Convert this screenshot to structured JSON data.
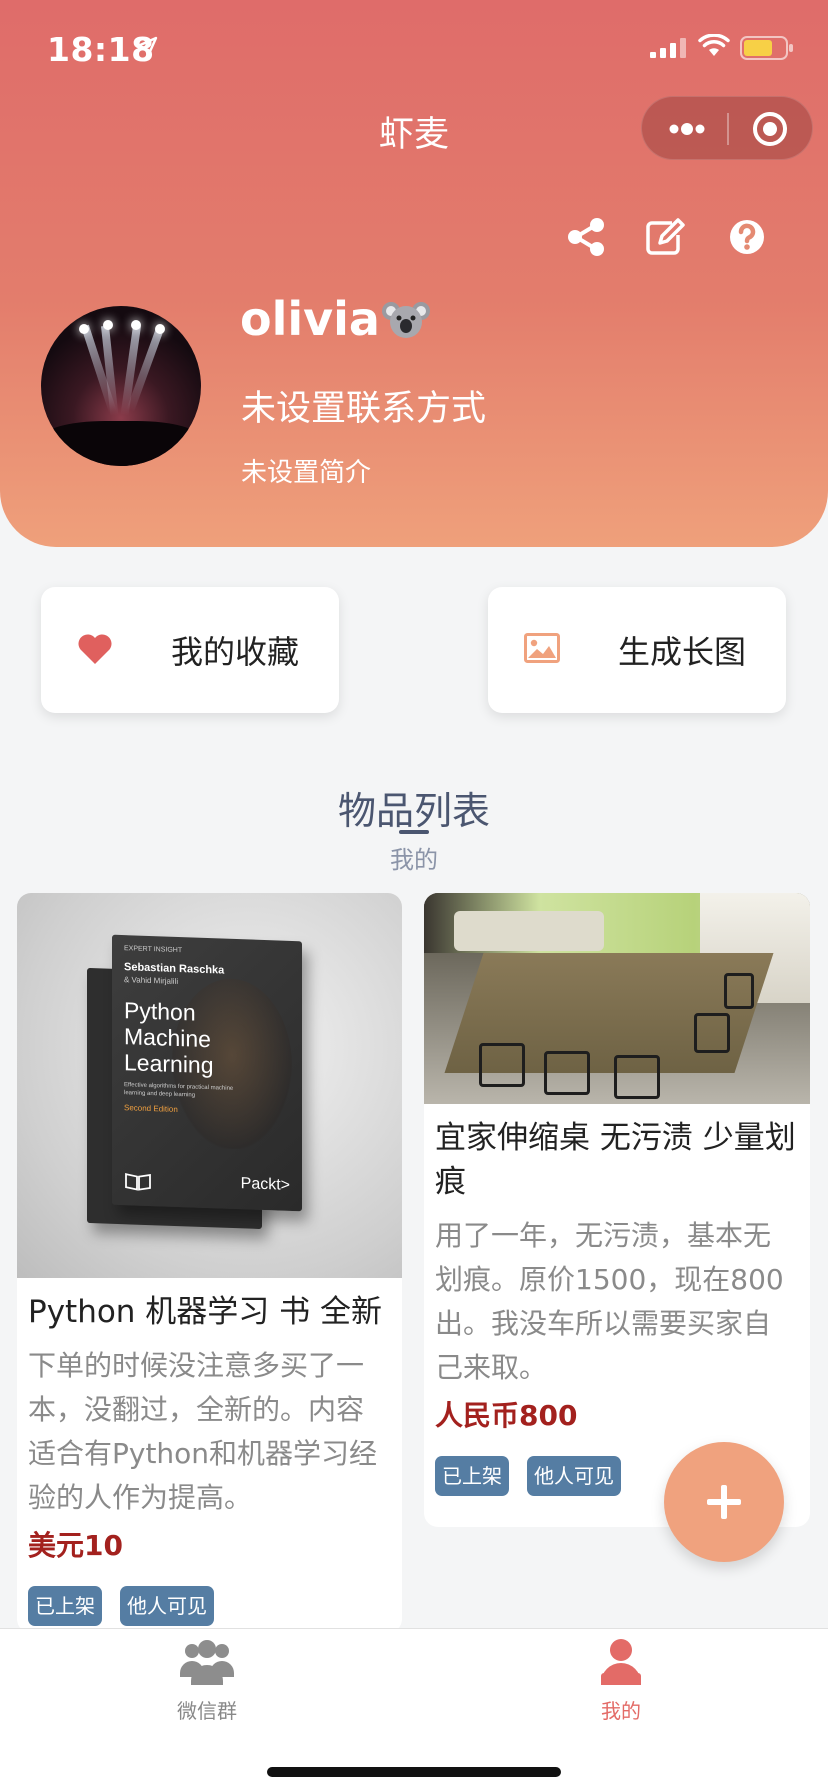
{
  "status_bar": {
    "time": "18:18"
  },
  "nav": {
    "title": "虾麦"
  },
  "profile": {
    "username": "olivia",
    "contact": "未设置联系方式",
    "bio": "未设置简介"
  },
  "actions": [
    {
      "label": "我的收藏",
      "icon": "heart-icon"
    },
    {
      "label": "生成长图",
      "icon": "image-icon"
    }
  ],
  "section": {
    "title": "物品列表",
    "subtitle": "我的"
  },
  "items": [
    {
      "title": "Python 机器学习 书 全新",
      "desc": "下单的时候没注意多买了一本，没翻过，全新的。内容适合有Python和机器学习经验的人作为提高。",
      "price": "美元10",
      "tags": [
        "已上架",
        "他人可见"
      ],
      "image": {
        "label": "EXPERT INSIGHT",
        "authors_1": "Sebastian Raschka",
        "authors_2": "& Vahid Mirjalili",
        "book_title_1": "Python",
        "book_title_2": "Machine",
        "book_title_3": "Learning",
        "tagline": "Effective algorithms for practical machine learning and deep learning",
        "edition": "Second Edition",
        "publisher": "Packt>"
      }
    },
    {
      "title": "宜家伸缩桌 无污渍 少量划痕",
      "desc": "用了一年，无污渍，基本无划痕。原价1500，现在800出。我没车所以需要买家自己来取。",
      "price": "人民币800",
      "tags": [
        "已上架",
        "他人可见"
      ]
    }
  ],
  "tabbar": [
    {
      "label": "微信群",
      "icon": "group-icon",
      "active": false
    },
    {
      "label": "我的",
      "icon": "user-icon",
      "active": true
    }
  ],
  "colors": {
    "header_top": "#df6c6a",
    "header_bottom": "#efa07b",
    "price": "#a3211e",
    "tag": "#557da3",
    "active_tab": "#e36b67",
    "fab": "#f0a27e"
  }
}
